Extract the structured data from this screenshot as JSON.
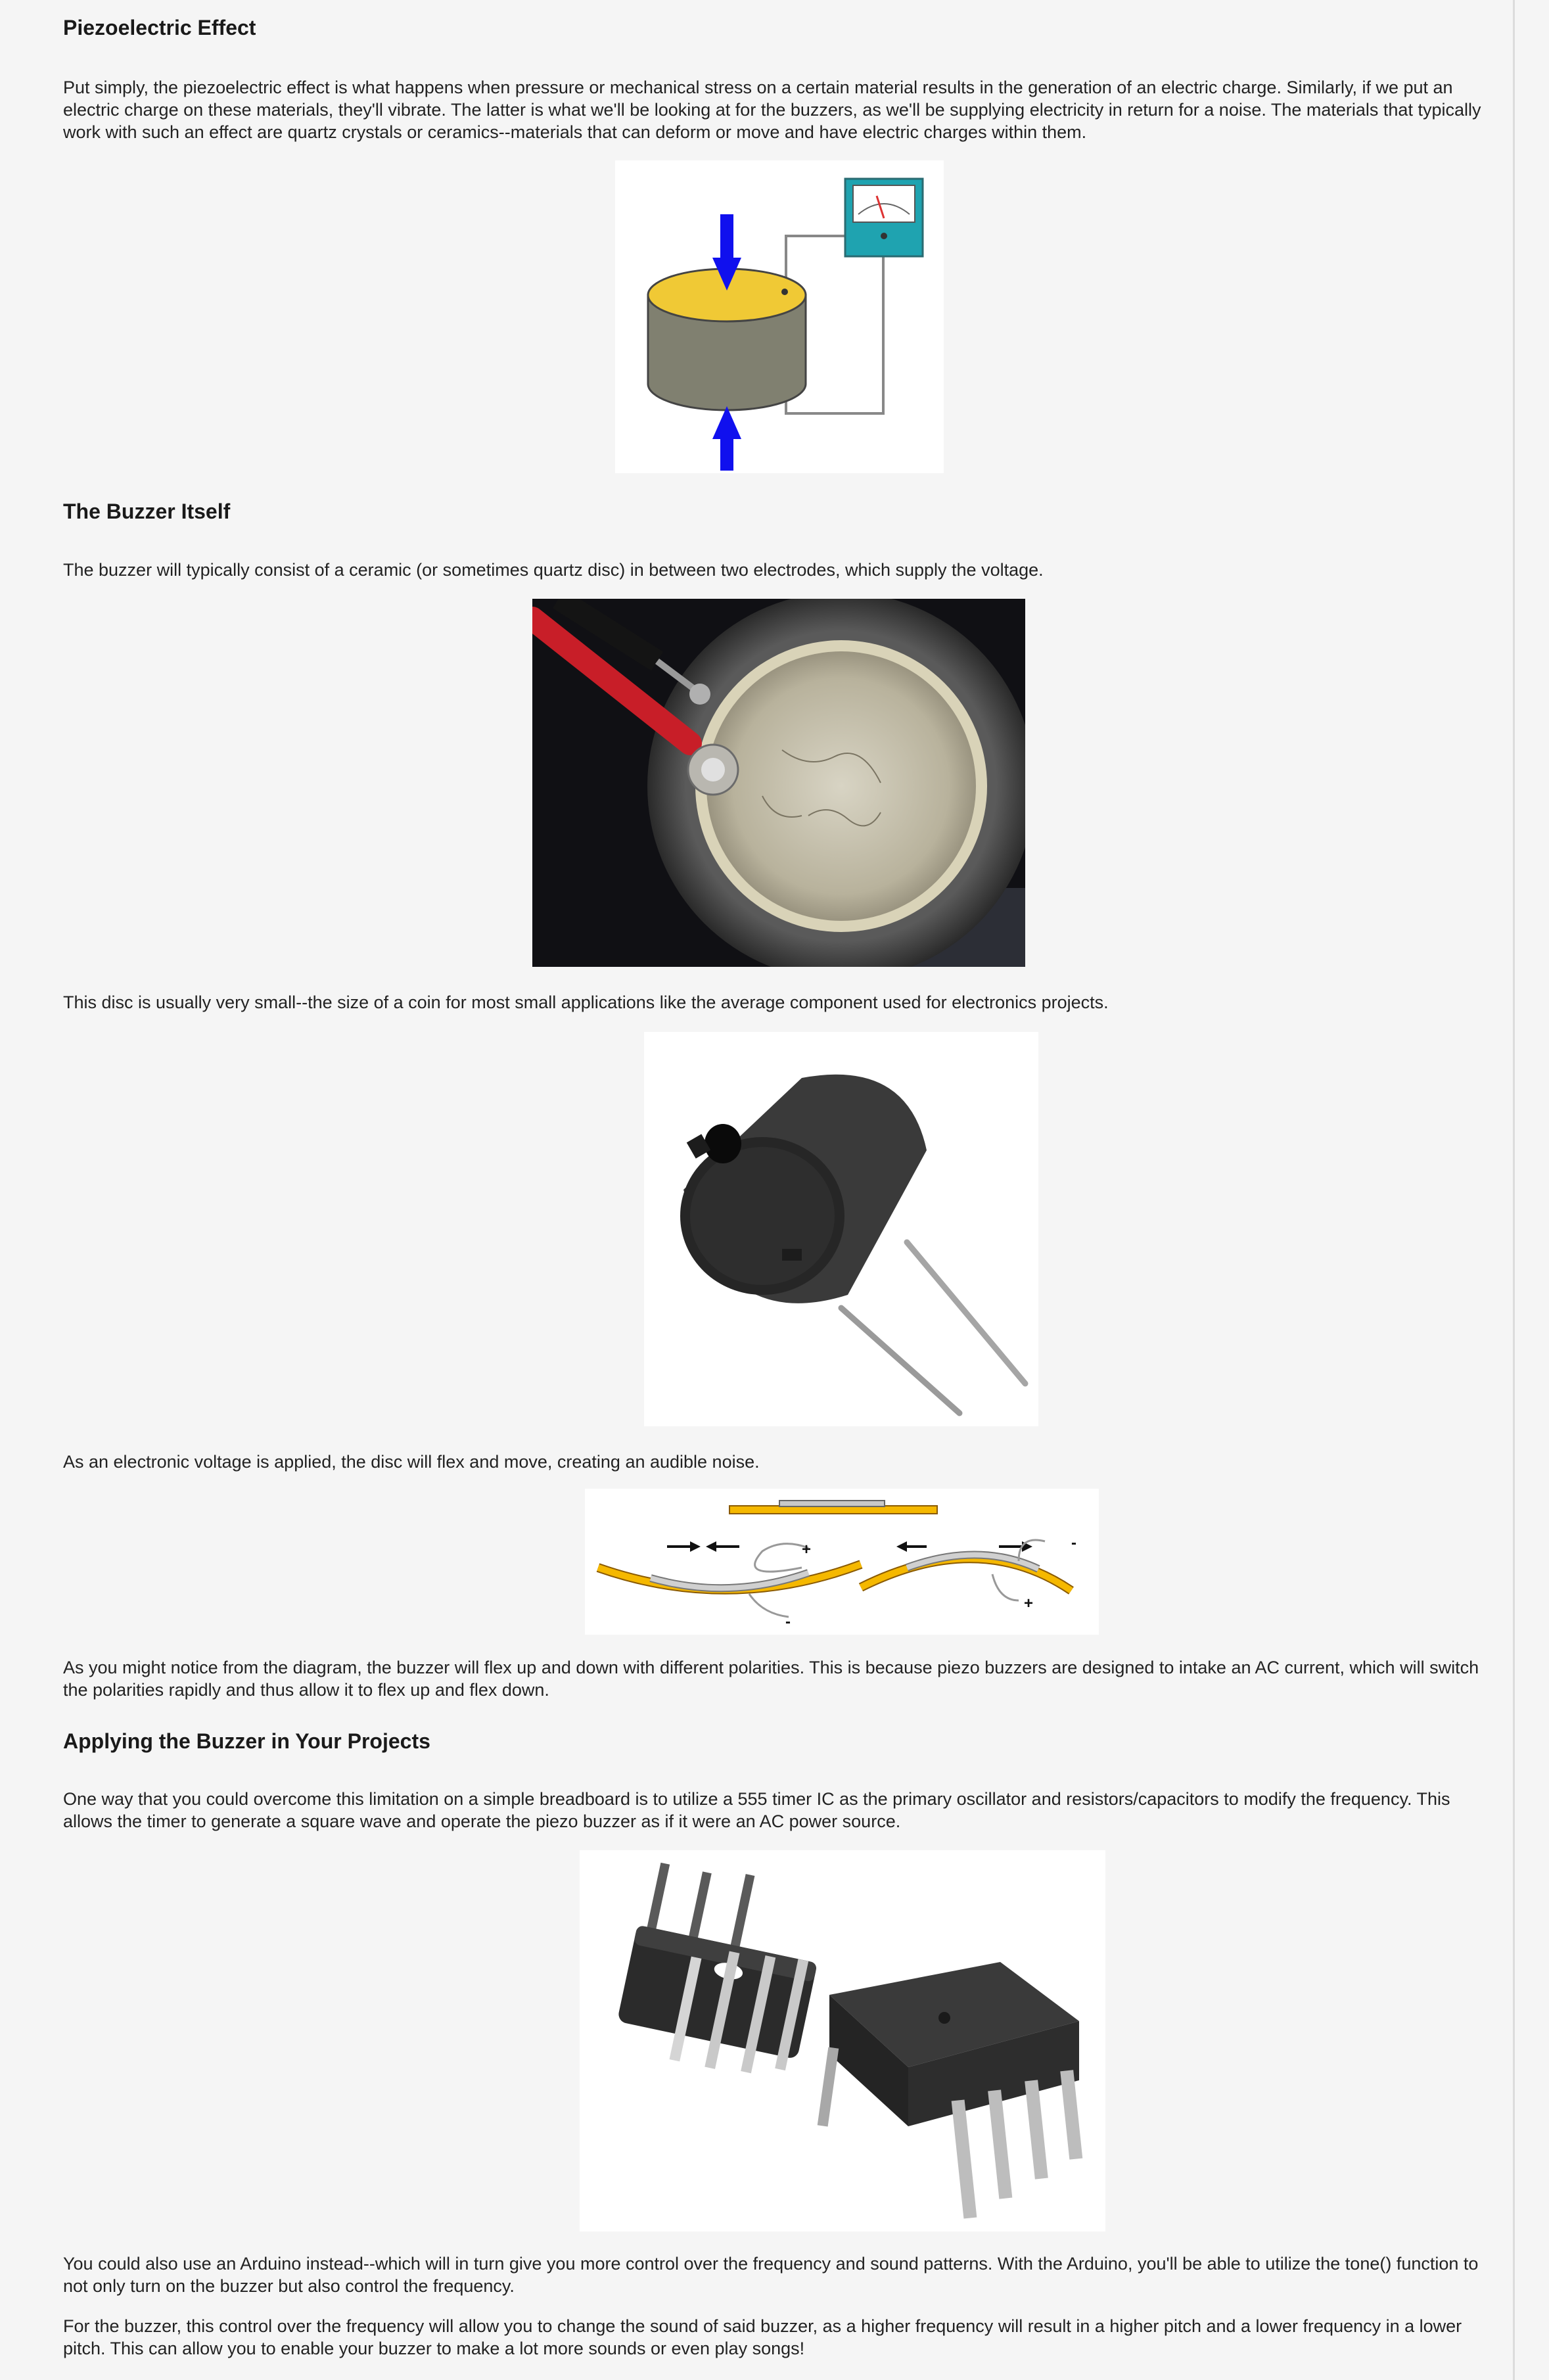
{
  "sections": {
    "piezo": {
      "heading": "Piezoelectric Effect",
      "intro": "Put simply, the piezoelectric effect is what happens when pressure or mechanical stress on a certain material results in the generation of an electric charge. Similarly, if we put an electric charge on these materials, they'll vibrate. The latter is what we'll be looking at for the buzzers, as we'll be supplying electricity in return for a noise. The materials that typically work with such an effect are quartz crystals or ceramics--materials that can deform or move and have electric charges within them."
    },
    "buzzer": {
      "heading": "The Buzzer Itself",
      "p1": "The buzzer will typically consist of a ceramic (or sometimes quartz disc) in between two electrodes, which supply the voltage.",
      "p2": "This disc is usually very small--the size of a coin for most small applications like the average component used for electronics projects.",
      "p3": "As an electronic voltage is applied, the disc will flex and move, creating an audible noise.",
      "p4": "As you might notice from the diagram, the buzzer will flex up and down with different polarities. This is because piezo buzzers are designed to intake an AC current, which will switch the polarities rapidly and thus allow it to flex up and flex down."
    },
    "applying": {
      "heading": "Applying the Buzzer in Your Projects",
      "p1": "One way that you could overcome this limitation on a simple breadboard is to utilize a 555 timer IC as the primary oscillator and resistors/capacitors to modify the frequency. This allows the timer to generate a square wave and operate the piezo buzzer as if it were an AC power source.",
      "p2": "You could also use an Arduino instead--which will in turn give you more control over the frequency and sound patterns. With the Arduino, you'll be able to utilize the tone() function to not only turn on the buzzer but also control the frequency.",
      "p3": "For the buzzer, this control over the frequency will allow you to change the sound of said buzzer, as a higher frequency will result in a higher pitch and a lower frequency in a lower pitch. This can allow you to enable your buzzer to make a lot more sounds or even play songs!"
    }
  },
  "diagram_labels": {
    "plus": "+",
    "minus": "-"
  }
}
